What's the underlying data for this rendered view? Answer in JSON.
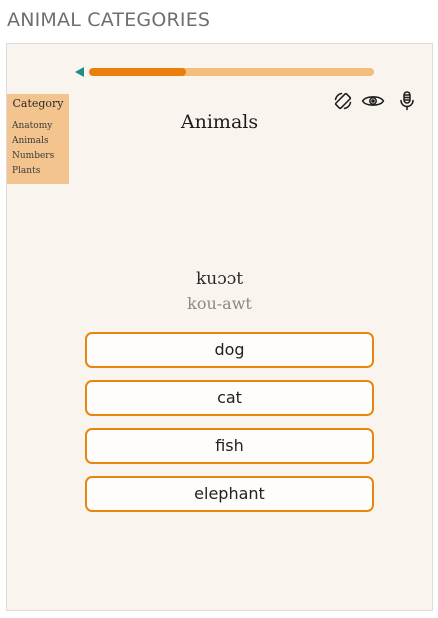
{
  "header": {
    "title": "ANIMAL CATEGORIES"
  },
  "progress": {
    "fraction": 0.34,
    "fill_color": "#ea7e0d",
    "track_color": "#f3bd7c"
  },
  "nav": {
    "back_icon": "back-arrow-icon"
  },
  "category_menu": {
    "heading": "Category",
    "items": [
      "Anatomy",
      "Animals",
      "Numbers",
      "Plants"
    ]
  },
  "toolbar": {
    "icons": [
      "rotate-icon",
      "eye-icon",
      "microphone-icon"
    ]
  },
  "lesson": {
    "title": "Animals",
    "native_word": "kuɔɔt",
    "pronunciation": "kou-awt"
  },
  "choices": [
    "dog",
    "cat",
    "fish",
    "elephant"
  ],
  "colors": {
    "accent": "#e8870f",
    "teal": "#1f8f86",
    "background": "#f9f4ee"
  }
}
